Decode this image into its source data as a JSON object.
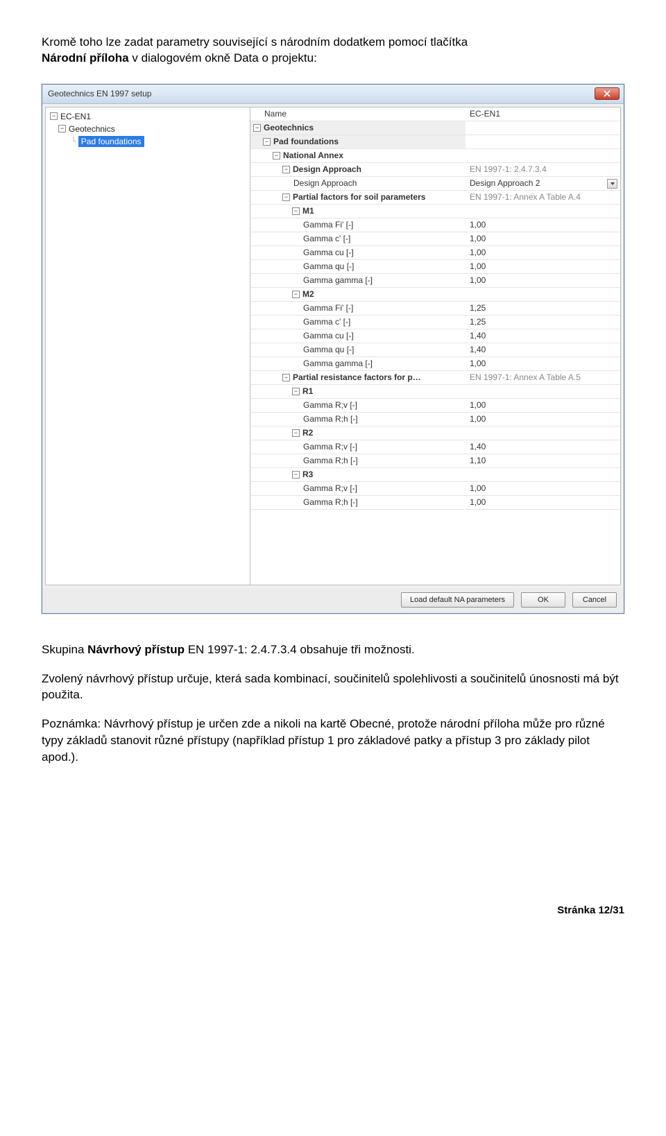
{
  "intro": {
    "line1": "Kromě toho lze zadat parametry související s národním dodatkem pomocí tlačítka",
    "boldPart": "Národní příloha",
    "line2rest": " v dialogovém okně Data o projektu:"
  },
  "dialog": {
    "title": "Geotechnics EN 1997 setup",
    "tree": {
      "root": "EC-EN1",
      "child1": "Geotechnics",
      "child2": "Pad foundations"
    },
    "header": {
      "nameLabel": "Name",
      "nameValue": "EC-EN1"
    },
    "groups": {
      "geotechnics": "Geotechnics",
      "padFoundations": "Pad foundations",
      "nationalAnnex": "National Annex",
      "designApproach": "Design Approach",
      "partialSoil": "Partial factors for soil parameters",
      "partialResist": "Partial resistance factors for p…",
      "m1": "M1",
      "m2": "M2",
      "r1": "R1",
      "r2": "R2",
      "r3": "R3"
    },
    "daRow": {
      "label": "Design Approach",
      "value": "Design Approach 2"
    },
    "daRef": "EN 1997-1: 2.4.7.3.4",
    "soilRef": "EN 1997-1: Annex A Table A.4",
    "resistRef": "EN 1997-1: Annex A Table A.5",
    "paramLabels": {
      "gfi": "Gamma Fi' [-]",
      "gc": "Gamma c' [-]",
      "gcu": "Gamma cu [-]",
      "gqu": "Gamma qu [-]",
      "gg": "Gamma gamma [-]",
      "grv": "Gamma R;v [-]",
      "grh": "Gamma R;h [-]"
    },
    "m1": {
      "gfi": "1,00",
      "gc": "1,00",
      "gcu": "1,00",
      "gqu": "1,00",
      "gg": "1,00"
    },
    "m2": {
      "gfi": "1,25",
      "gc": "1,25",
      "gcu": "1,40",
      "gqu": "1,40",
      "gg": "1,00"
    },
    "r1": {
      "grv": "1,00",
      "grh": "1,00"
    },
    "r2": {
      "grv": "1,40",
      "grh": "1,10"
    },
    "r3": {
      "grv": "1,00",
      "grh": "1,00"
    },
    "buttons": {
      "loadDefault": "Load default NA parameters",
      "ok": "OK",
      "cancel": "Cancel"
    }
  },
  "after": {
    "p1a": "Skupina ",
    "p1b": "Návrhový přístup",
    "p1c": " EN 1997-1: 2.4.7.3.4 obsahuje tři možnosti.",
    "p2": "Zvolený návrhový přístup určuje, která sada kombinací, součinitelů spolehlivosti a součinitelů únosnosti má být použita.",
    "p3": "Poznámka: Návrhový přístup je určen zde a nikoli na kartě Obecné, protože národní příloha může pro různé typy základů stanovit různé přístupy (například přístup 1 pro základové patky a přístup 3 pro základy pilot apod.)."
  },
  "footer": "Stránka 12/31"
}
